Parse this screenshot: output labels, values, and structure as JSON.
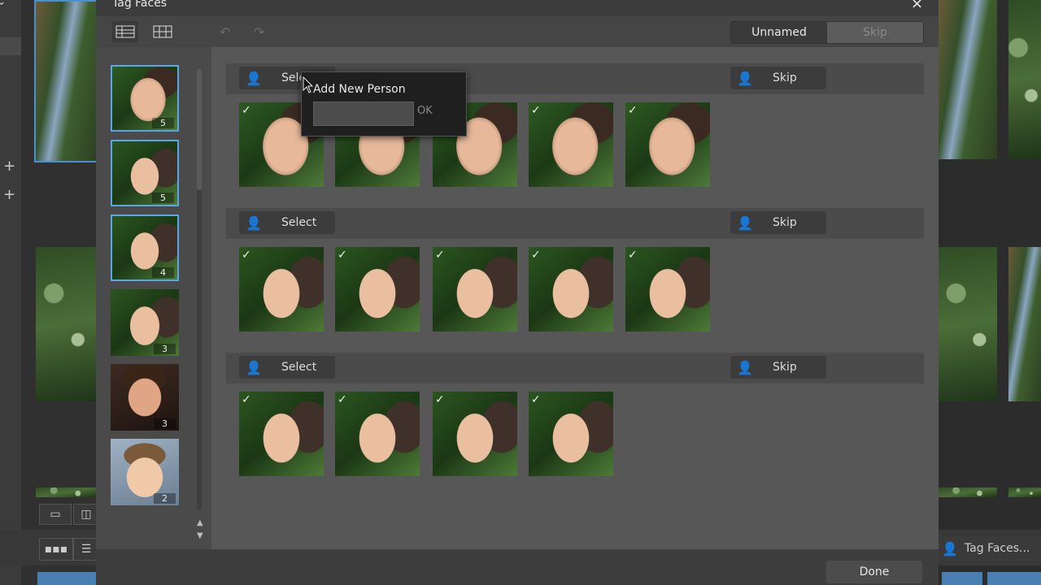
{
  "dialog": {
    "title": "Tag Faces",
    "close_icon": "×",
    "toolbar": {
      "view_list_icon": "list-view-icon",
      "view_grid_icon": "grid-view-icon",
      "undo_icon": "undo-icon",
      "redo_icon": "redo-icon",
      "filter_unnamed": "Unnamed",
      "filter_skip": "Skip"
    },
    "people": [
      {
        "count": "5",
        "selected": true
      },
      {
        "count": "5",
        "selected": true
      },
      {
        "count": "4",
        "selected": true
      },
      {
        "count": "3",
        "selected": false
      },
      {
        "count": "3",
        "selected": false
      },
      {
        "count": "2",
        "selected": false
      }
    ],
    "groups": [
      {
        "select_label": "Select",
        "skip_label": "Skip",
        "face_count": 5
      },
      {
        "select_label": "Select",
        "skip_label": "Skip",
        "face_count": 5
      },
      {
        "select_label": "Select",
        "skip_label": "Skip",
        "face_count": 4
      }
    ],
    "done_label": "Done"
  },
  "popup": {
    "title": "Add New Person",
    "input_value": "",
    "ok_label": "OK"
  },
  "background": {
    "tag_faces_button": "Tag Faces..."
  }
}
